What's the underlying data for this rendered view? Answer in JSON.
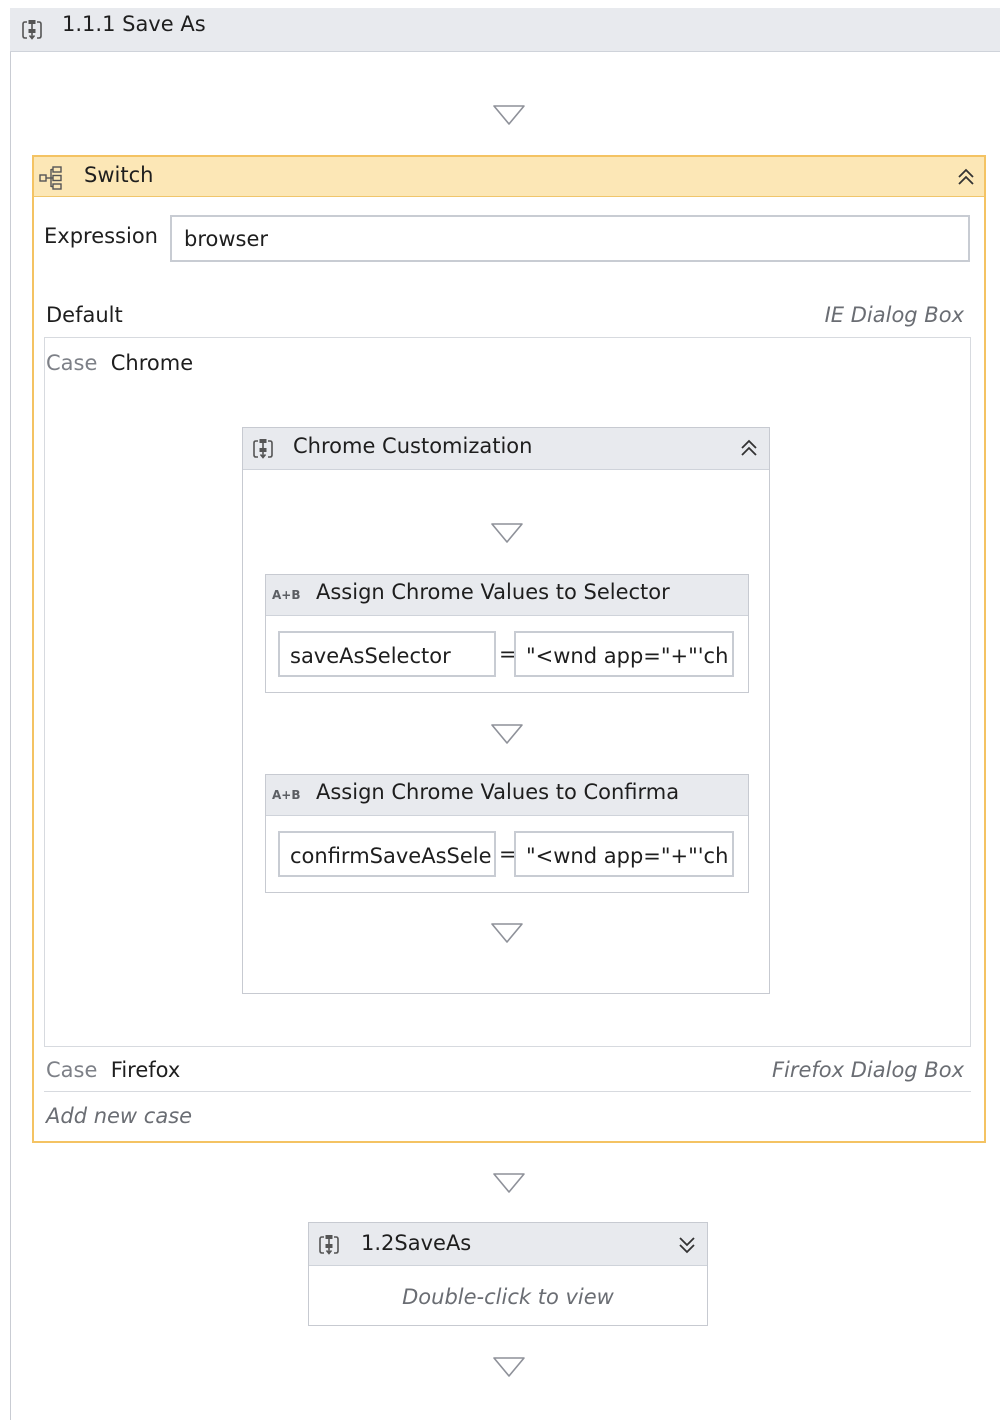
{
  "outer": {
    "title": "1.1.1 Save As"
  },
  "switch": {
    "title": "Switch",
    "expression_label": "Expression",
    "expression_value": "browser",
    "default_label": "Default",
    "default_target": "IE Dialog Box",
    "case_word": "Case",
    "cases": [
      {
        "name": "Chrome"
      },
      {
        "name": "Firefox",
        "target": "Firefox Dialog Box"
      }
    ],
    "add_case": "Add new case"
  },
  "chrome_sequence": {
    "title": "Chrome Customization",
    "assigns": [
      {
        "icon_text": "A+B",
        "title": "Assign Chrome Values to Selector",
        "lhs": "saveAsSelector",
        "eq": "=",
        "rhs": "\"<wnd app=\"+\"'ch"
      },
      {
        "icon_text": "A+B",
        "title": "Assign Chrome Values to Confirma",
        "lhs": "confirmSaveAsSele",
        "eq": "=",
        "rhs": "\"<wnd app=\"+\"'ch"
      }
    ]
  },
  "next_activity": {
    "title": "1.2SaveAs",
    "hint": "Double-click to view"
  },
  "colors": {
    "switch_border": "#f4c363",
    "switch_header": "#fce7b6",
    "header_gray": "#e8eaee",
    "drop_arrow": "#8e9199"
  },
  "icons": [
    "sequence-icon",
    "switch-icon",
    "collapse-icon",
    "expand-icon",
    "drop-arrow-icon"
  ]
}
